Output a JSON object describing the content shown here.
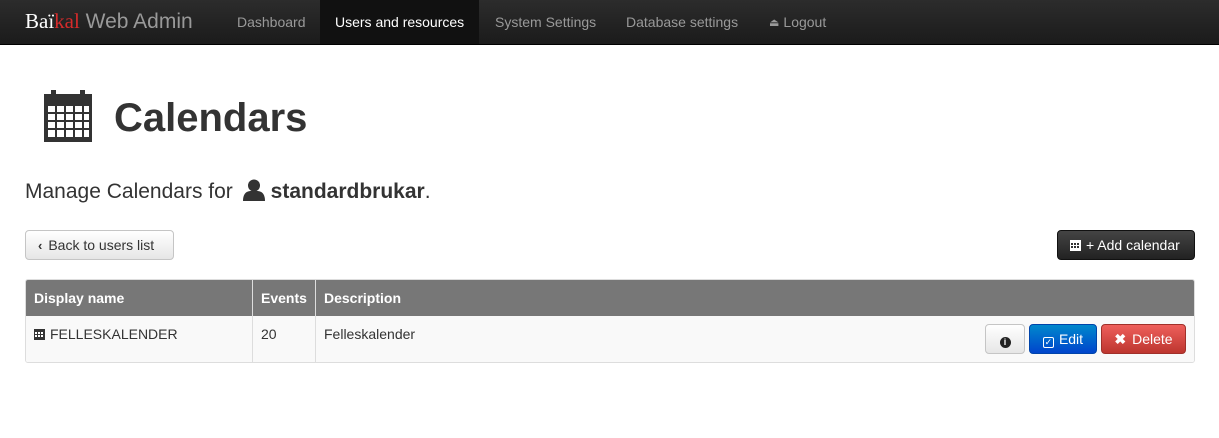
{
  "brand": {
    "part1": "Baï",
    "part2": "kal",
    "part3": " Web Admin"
  },
  "nav": {
    "items": [
      {
        "label": "Dashboard"
      },
      {
        "label": "Users and resources"
      },
      {
        "label": "System Settings"
      },
      {
        "label": "Database settings"
      },
      {
        "label": "Logout"
      }
    ],
    "active": "Users and resources"
  },
  "page": {
    "title": "Calendars",
    "subtitle_prefix": "Manage Calendars for",
    "username": "standardbrukar",
    "subtitle_suffix": "."
  },
  "buttons": {
    "back": "Back to users list",
    "add": "+ Add calendar"
  },
  "table": {
    "headers": [
      "Display name",
      "Events",
      "Description"
    ],
    "rows": [
      {
        "display_name": "FELLESKALENDER",
        "events": "20",
        "description": "Felleskalender",
        "actions": {
          "info": "i",
          "edit": "Edit",
          "delete": "Delete"
        }
      }
    ]
  },
  "icons": {
    "page": "calendar-icon",
    "user": "user-icon",
    "back": "chevron-left-icon",
    "add": "calendar-icon",
    "row": "calendar-icon",
    "info": "info-icon",
    "edit": "edit-icon",
    "delete": "close-icon",
    "logout": "eject-icon"
  },
  "colors": {
    "navbar": "#1b1b1b",
    "brand_accent": "#d52b2b",
    "edit_button": "#0066cc",
    "delete_button": "#da4f49",
    "table_header": "#777777"
  }
}
